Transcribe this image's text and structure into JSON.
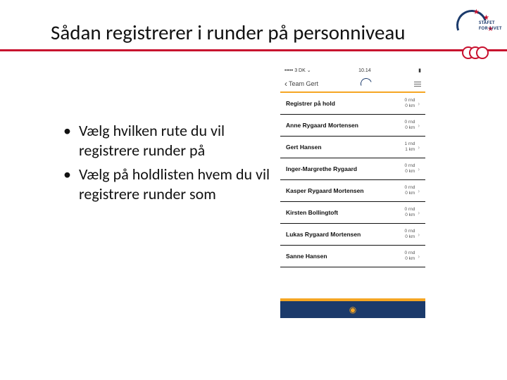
{
  "title": "Sådan registrerer i runder på personniveau",
  "logo": {
    "brand_line1": "STAFET",
    "brand_line2": "FOR LIVET"
  },
  "bullets": [
    "Vælg hvilken rute du vil registrere runder på",
    "Vælg på holdlisten hvem du vil registrere runder som"
  ],
  "phone": {
    "status": {
      "left": "••••• 3 DK ⌄",
      "center": "10.14",
      "right": "▮"
    },
    "back_label": "Team Gert",
    "rows": [
      {
        "name": "Registrer på hold",
        "m1": "0 rnd",
        "m2": "0 km"
      },
      {
        "name": "Anne Rygaard Mortensen",
        "m1": "0 rnd",
        "m2": "0 km"
      },
      {
        "name": "Gert Hansen",
        "m1": "1 rnd",
        "m2": "1 km"
      },
      {
        "name": "Inger-Margrethe Rygaard",
        "m1": "0 rnd",
        "m2": "0 km"
      },
      {
        "name": "Kasper Rygaard Mortensen",
        "m1": "0 rnd",
        "m2": "0 km"
      },
      {
        "name": "Kirsten Bollingtoft",
        "m1": "0 rnd",
        "m2": "0 km"
      },
      {
        "name": "Lukas Rygaard Mortensen",
        "m1": "0 rnd",
        "m2": "0 km"
      },
      {
        "name": "Sanne Hansen",
        "m1": "0 rnd",
        "m2": "0 km"
      }
    ]
  }
}
